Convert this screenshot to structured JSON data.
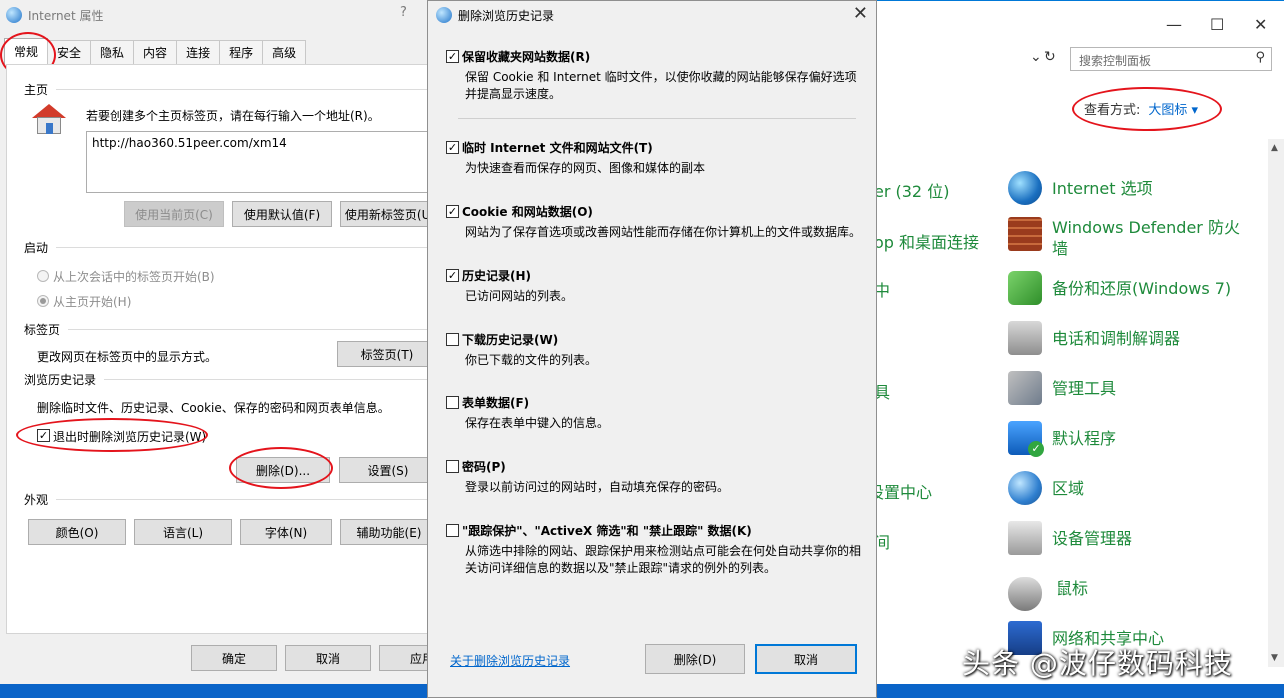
{
  "internet_options": {
    "title": "Internet 属性",
    "help": "?",
    "tabs": [
      "常规",
      "安全",
      "隐私",
      "内容",
      "连接",
      "程序",
      "高级"
    ],
    "homepage": {
      "group": "主页",
      "hint": "若要创建多个主页标签页，请在每行输入一个地址(R)。",
      "url": "http://hao360.51peer.com/xm14",
      "btn_current": "使用当前页(C)",
      "btn_default": "使用默认值(F)",
      "btn_newtab": "使用新标签页(U)"
    },
    "startup": {
      "group": "启动",
      "opt_last": "从上次会话中的标签页开始(B)",
      "opt_home": "从主页开始(H)"
    },
    "tabsgroup": {
      "group": "标签页",
      "desc": "更改网页在标签页中的显示方式。",
      "btn": "标签页(T)"
    },
    "history": {
      "group": "浏览历史记录",
      "desc": "删除临时文件、历史记录、Cookie、保存的密码和网页表单信息。",
      "exit_delete": "退出时删除浏览历史记录(W)",
      "btn_delete": "删除(D)...",
      "btn_settings": "设置(S)"
    },
    "appearance": {
      "group": "外观",
      "btn_colors": "颜色(O)",
      "btn_languages": "语言(L)",
      "btn_fonts": "字体(N)",
      "btn_accessibility": "辅助功能(E)"
    },
    "footer": {
      "ok": "确定",
      "cancel": "取消",
      "apply": "应用"
    }
  },
  "delete_dialog": {
    "title": "删除浏览历史记录",
    "close": "✕",
    "options": [
      {
        "label": "保留收藏夹网站数据(R)",
        "desc": "保留 Cookie 和 Internet 临时文件，以使你收藏的网站能够保存偏好选项并提高显示速度。",
        "checked": true
      },
      {
        "label": "临时 Internet 文件和网站文件(T)",
        "desc": "为快速查看而保存的网页、图像和媒体的副本",
        "checked": true
      },
      {
        "label": "Cookie 和网站数据(O)",
        "desc": "网站为了保存首选项或改善网站性能而存储在你计算机上的文件或数据库。",
        "checked": true
      },
      {
        "label": "历史记录(H)",
        "desc": "已访问网站的列表。",
        "checked": true
      },
      {
        "label": "下载历史记录(W)",
        "desc": "你已下载的文件的列表。",
        "checked": false
      },
      {
        "label": "表单数据(F)",
        "desc": "保存在表单中键入的信息。",
        "checked": false
      },
      {
        "label": "密码(P)",
        "desc": "登录以前访问过的网站时，自动填充保存的密码。",
        "checked": false
      },
      {
        "label": "\"跟踪保护\"、\"ActiveX 筛选\"和 \"禁止跟踪\" 数据(K)",
        "desc": "从筛选中排除的网站、跟踪保护用来检测站点可能会在何处自动共享你的相关访问详细信息的数据以及\"禁止跟踪\"请求的例外的列表。",
        "checked": false
      }
    ],
    "about_link": "关于删除浏览历史记录",
    "btn_delete": "删除(D)",
    "btn_cancel": "取消"
  },
  "control_panel": {
    "search_placeholder": "搜索控制面板",
    "view_by_label": "查看方式:",
    "view_by_value": "大图标 ▾",
    "items": [
      {
        "label": "Internet 选项",
        "icon": "globe-icon"
      },
      {
        "label": "Windows Defender 防火墙",
        "icon": "firewall-icon"
      },
      {
        "label": "备份和还原(Windows 7)",
        "icon": "backup-icon"
      },
      {
        "label": "电话和调制解调器",
        "icon": "phone-icon"
      },
      {
        "label": "管理工具",
        "icon": "tools-icon"
      },
      {
        "label": "默认程序",
        "icon": "default-programs-icon"
      },
      {
        "label": "区域",
        "icon": "region-icon"
      },
      {
        "label": "设备管理器",
        "icon": "device-manager-icon"
      },
      {
        "label": "鼠标",
        "icon": "mouse-icon"
      },
      {
        "label": "网络和共享中心",
        "icon": "network-icon"
      }
    ],
    "left_fragments": [
      "er (32 位)",
      "op 和桌面连接",
      "中",
      "具",
      "设置中心",
      "间"
    ]
  },
  "watermark": "头条 @波仔数码科技",
  "colors": {
    "annotation": "#e4141c",
    "link": "#0066cc",
    "cp_label": "#1e8a3b"
  }
}
